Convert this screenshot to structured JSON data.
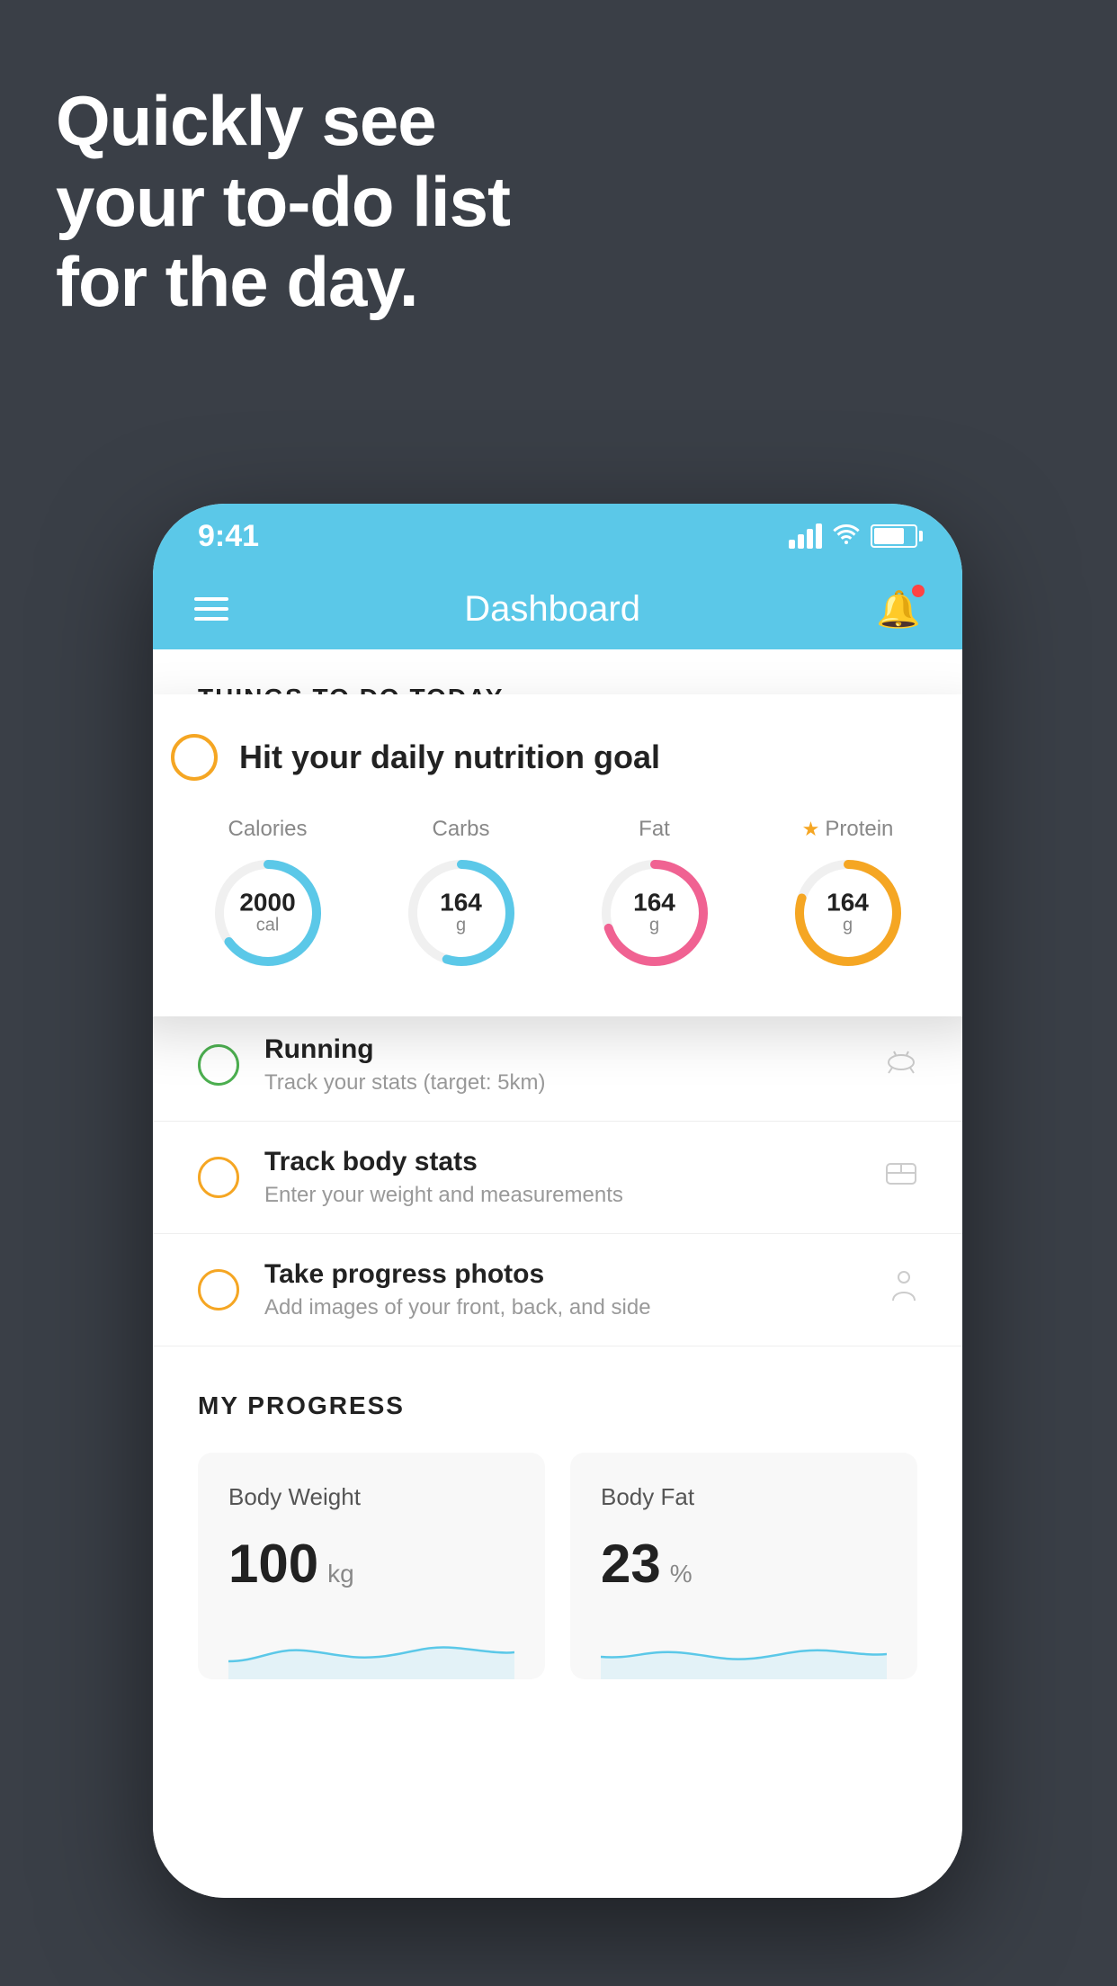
{
  "background": {
    "color": "#3a3f47"
  },
  "headline": {
    "line1": "Quickly see",
    "line2": "your to-do list",
    "line3": "for the day."
  },
  "phone": {
    "statusBar": {
      "time": "9:41"
    },
    "navBar": {
      "title": "Dashboard"
    },
    "thingsToDoSection": {
      "title": "THINGS TO DO TODAY"
    },
    "nutritionCard": {
      "checkCircleColor": "#f5a623",
      "title": "Hit your daily nutrition goal",
      "items": [
        {
          "label": "Calories",
          "value": "2000",
          "unit": "cal",
          "ringColor": "#5bc8e8",
          "percent": 65
        },
        {
          "label": "Carbs",
          "value": "164",
          "unit": "g",
          "ringColor": "#5bc8e8",
          "percent": 55
        },
        {
          "label": "Fat",
          "value": "164",
          "unit": "g",
          "ringColor": "#f06292",
          "percent": 70
        },
        {
          "label": "Protein",
          "value": "164",
          "unit": "g",
          "ringColor": "#f5a623",
          "percent": 80,
          "starred": true
        }
      ]
    },
    "todoItems": [
      {
        "name": "Running",
        "sub": "Track your stats (target: 5km)",
        "circleColor": "green",
        "icon": "👟"
      },
      {
        "name": "Track body stats",
        "sub": "Enter your weight and measurements",
        "circleColor": "yellow",
        "icon": "⚖"
      },
      {
        "name": "Take progress photos",
        "sub": "Add images of your front, back, and side",
        "circleColor": "yellow",
        "icon": "👤"
      }
    ],
    "progressSection": {
      "title": "MY PROGRESS",
      "cards": [
        {
          "label": "Body Weight",
          "value": "100",
          "unit": "kg"
        },
        {
          "label": "Body Fat",
          "value": "23",
          "unit": "%"
        }
      ]
    }
  }
}
